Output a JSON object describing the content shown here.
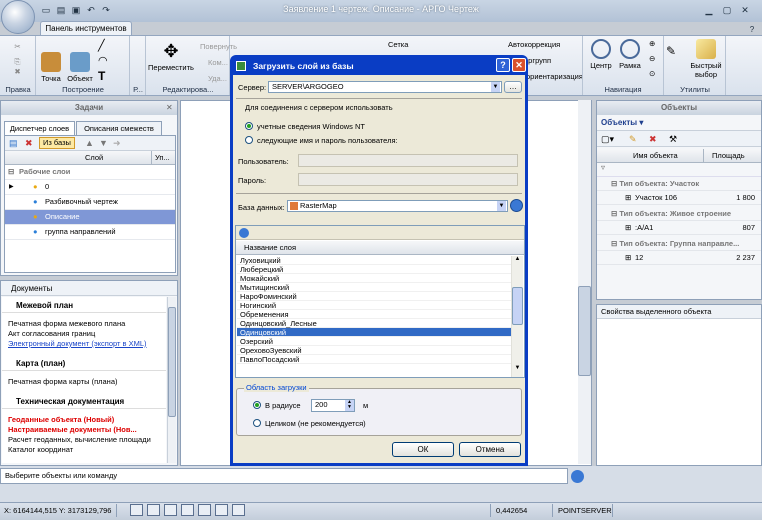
{
  "window": {
    "title": "Заявление 1 чертеж. Описание - АРГО Чертеж"
  },
  "ribbon": {
    "tab": "Панель инструментов",
    "groups": {
      "pravka": "Правка",
      "postroenie": "Построение",
      "p": "Р...",
      "redakt": "Редактирова...",
      "navigation": "Навигация",
      "utility": "Утилиты"
    },
    "buttons": {
      "tochka": "Точка",
      "object": "Объект",
      "peremestit": "Переместить",
      "povernut": "Повернуть",
      "kom": "Ком...",
      "uda": "Уда...",
      "setka": "Сетка",
      "autocorrect": "Автокоррекция",
      "argrupt": "аргрупп",
      "orient": "ориентаризация",
      "centr": "Центр",
      "ramka": "Рамка",
      "fast": "Быстрый выбор"
    }
  },
  "left": {
    "header": "Задачи",
    "tabs": [
      "Диспетчер слоев",
      "Описания смежеств"
    ],
    "toolbar_label": "Из базы",
    "col_layer": "Слой",
    "col_extra": "Уп...",
    "group": "Рабочие слои",
    "layers": [
      "0",
      "Разбивочный чертеж",
      "Описание",
      "группа направлений"
    ]
  },
  "docs": {
    "title": "Документы",
    "sections": [
      {
        "title": "Межевой план",
        "items": [
          {
            "t": "Печатная форма межевого плана",
            "k": "plain"
          },
          {
            "t": "Акт согласования границ",
            "k": "plain"
          },
          {
            "t": "Электронный документ (экспорт в XML)",
            "k": "link"
          }
        ]
      },
      {
        "title": "Карта (план)",
        "items": [
          {
            "t": "Печатная форма карты (плана)",
            "k": "plain"
          }
        ]
      },
      {
        "title": "Техническая документация",
        "items": [
          {
            "t": "Геоданные объекта (Новый)",
            "k": "red"
          },
          {
            "t": "Настраиваемые документы (Нов...",
            "k": "red"
          },
          {
            "t": "Расчет геоданных, вычисление площади",
            "k": "plain"
          },
          {
            "t": "Каталог координат",
            "k": "plain"
          }
        ]
      }
    ]
  },
  "right": {
    "header": "Объекты",
    "filter": "Объекты",
    "col_name": "Имя объекта",
    "col_area": "Площадь",
    "groups": [
      {
        "title": "Тип объекта: Участок",
        "name": "Участок 106",
        "area": "1 800"
      },
      {
        "title": "Тип объекта: Живое строение",
        "name": ":А/А1",
        "area": "807"
      },
      {
        "title": "Тип объекта: Группа направле...",
        "name": "12",
        "area": "2 237"
      }
    ],
    "props": "Свойства выделенного объекта"
  },
  "dialog": {
    "title": "Загрузить слой из базы",
    "server_label": "Сервер:",
    "server_value": "SERVER\\ARGOGEO",
    "connect_label": "Для соединения с сервером использовать",
    "opt1": "учетные сведения Windows NT",
    "opt2": "следующие имя и пароль пользователя:",
    "user_label": "Пользователь:",
    "pass_label": "Пароль:",
    "db_label": "База данных:",
    "db_value": "RasterMap",
    "list_header": "Название слоя",
    "layers": [
      "Луховицкий",
      "Люберецкий",
      "Можайский",
      "Мытищинский",
      "НароФоминский",
      "Ногинский",
      "Обременения",
      "Одинцовский_Лесные",
      "Одинцовский",
      "Озерский",
      "ОреховоЗуевский",
      "ПавлоПосадский"
    ],
    "selected": "Одинцовский",
    "area_label": "Область загрузки",
    "radius_label": "В радиусе",
    "radius_value": "200",
    "radius_unit": "м",
    "whole_label": "Целиком (не рекомендуется)",
    "ok": "ОК",
    "cancel": "Отмена"
  },
  "status": {
    "text": "Выберите объекты или команду"
  },
  "bottom": {
    "coords": "X: 6164144,515 Y: 3173129,796",
    "scale": "0,442654",
    "server": "POINTSERVER"
  }
}
